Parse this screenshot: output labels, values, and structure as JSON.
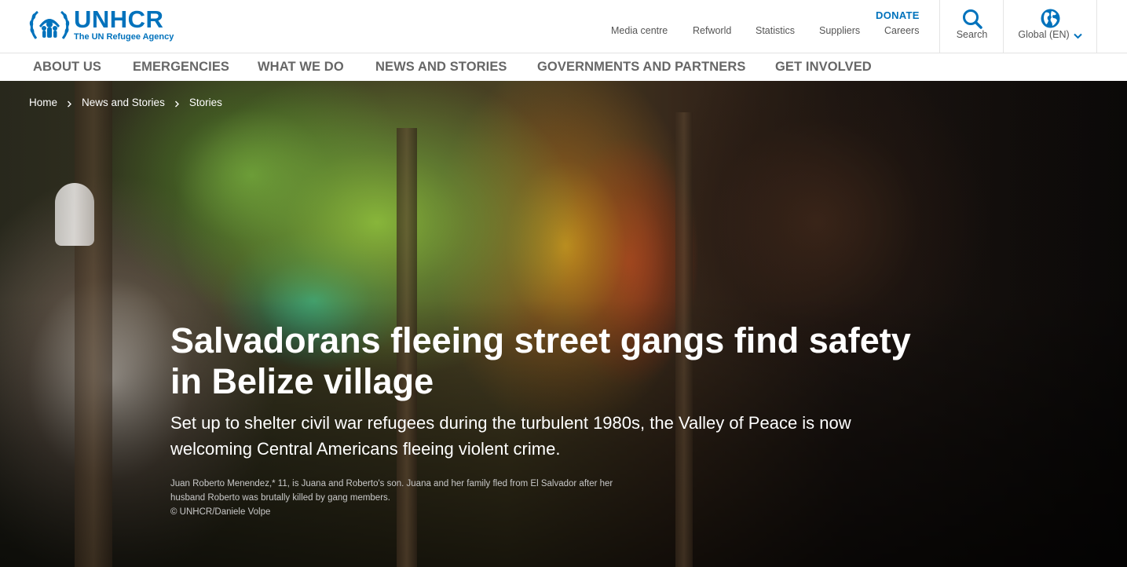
{
  "brand": {
    "name": "UNHCR",
    "tagline": "The UN Refugee Agency",
    "color": "#0072bc"
  },
  "header": {
    "donate_label": "DONATE",
    "util_links": [
      "Media centre",
      "Refworld",
      "Statistics",
      "Suppliers",
      "Careers"
    ],
    "search_label": "Search",
    "locale_label": "Global (EN)"
  },
  "nav": {
    "items": [
      "ABOUT US",
      "EMERGENCIES",
      "WHAT WE DO",
      "NEWS AND STORIES",
      "GOVERNMENTS AND PARTNERS",
      "GET INVOLVED"
    ]
  },
  "hero": {
    "breadcrumb": [
      "Home",
      "News and Stories",
      "Stories"
    ],
    "title_line1": "Salvadorans fleeing street gangs find safety",
    "title_line2": "in Belize village",
    "subtitle_line1": "Set up to shelter civil war refugees during the turbulent 1980s, the Valley of Peace is now",
    "subtitle_line2": "welcoming Central Americans fleeing violent crime.",
    "caption_line1": "Juan Roberto Menendez,* 11, is Juana and Roberto's son. Juana and her family fled from El Salvador after her",
    "caption_line2": "husband Roberto was brutally killed by gang members.",
    "credit": "© UNHCR/Daniele Volpe"
  },
  "icons": {
    "logo": "unhcr-emblem-icon",
    "search": "search-icon",
    "locale": "globe-icon",
    "chevron": "chevron-down-icon",
    "breadcrumb_separator": "chevron-right-icon"
  }
}
